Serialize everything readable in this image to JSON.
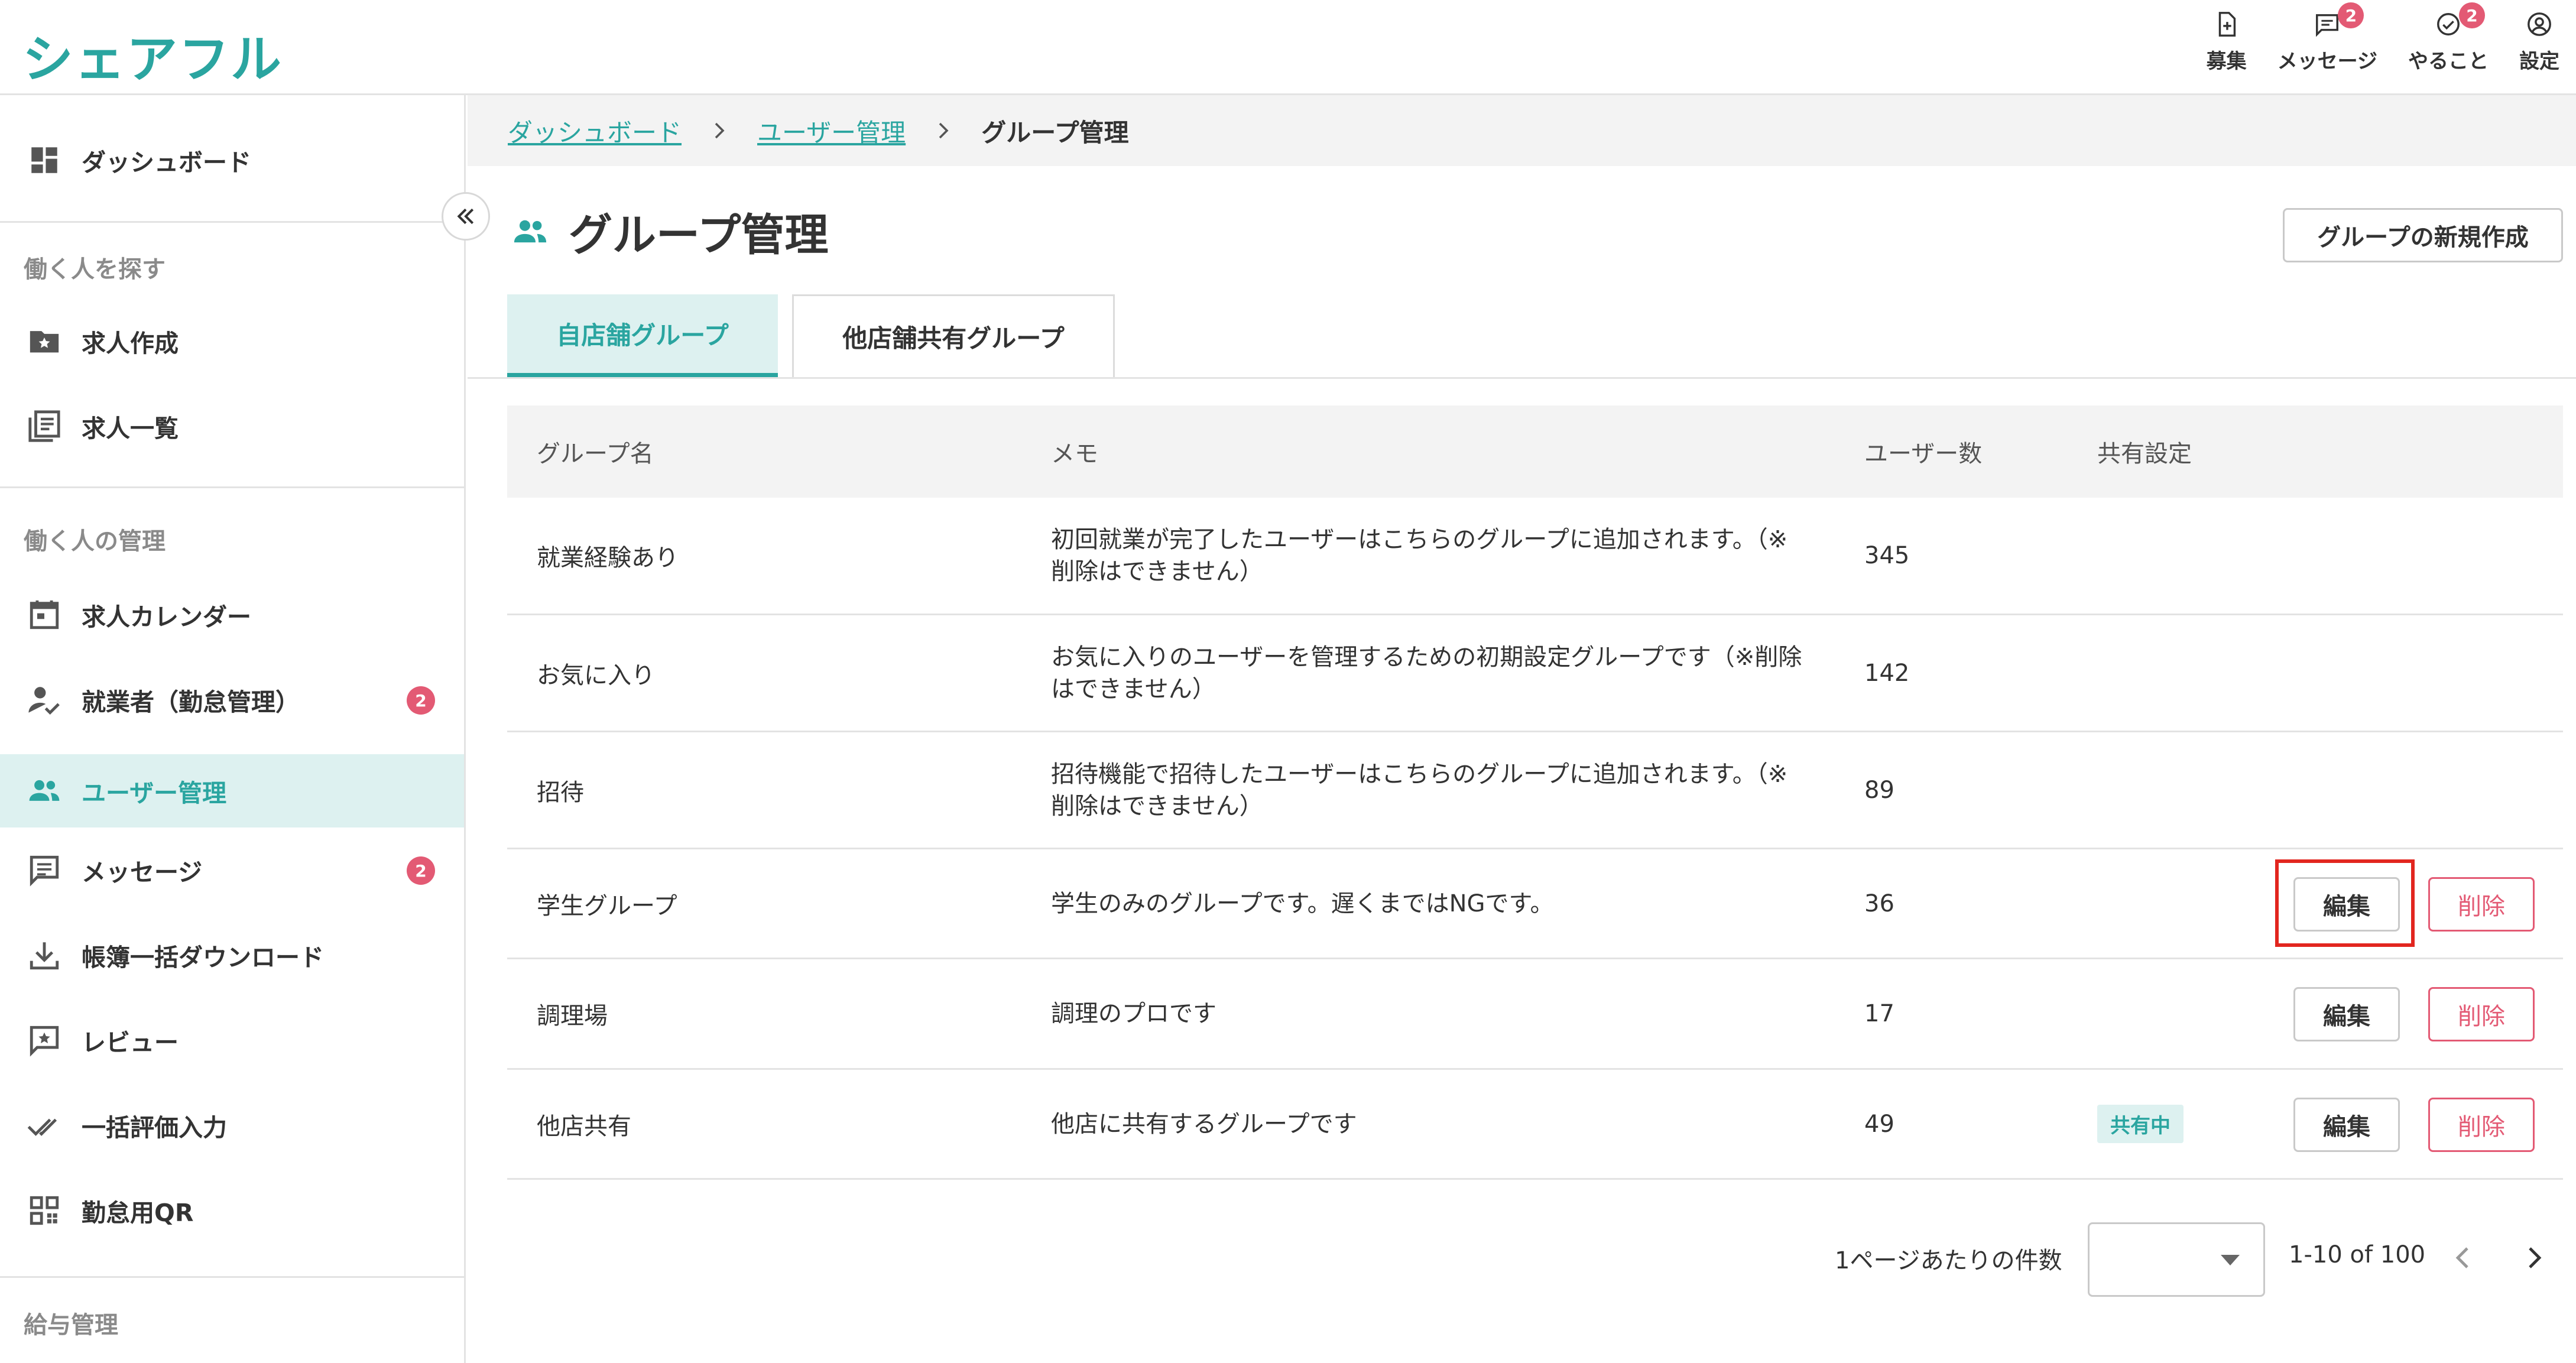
{
  "app": {
    "logo": "シェアフル"
  },
  "header": {
    "items": [
      {
        "label": "募集",
        "icon": "add-document-icon",
        "badge": ""
      },
      {
        "label": "メッセージ",
        "icon": "message-icon",
        "badge": "2"
      },
      {
        "label": "やること",
        "icon": "check-circle-icon",
        "badge": "2"
      },
      {
        "label": "設定",
        "icon": "account-circle-icon",
        "badge": ""
      }
    ]
  },
  "sidebar": {
    "dashboard": "ダッシュボード",
    "section_find": "働く人を探す",
    "job_create": "求人作成",
    "job_list": "求人一覧",
    "section_manage": "働く人の管理",
    "job_calendar": "求人カレンダー",
    "workers": "就業者（勤怠管理）",
    "workers_badge": "2",
    "user_management": "ユーザー管理",
    "messages": "メッセージ",
    "messages_badge": "2",
    "ledger_download": "帳簿一括ダウンロード",
    "review": "レビュー",
    "bulk_rating": "一括評価入力",
    "attendance_qr": "勤怠用QR",
    "section_payroll": "給与管理"
  },
  "breadcrumb": {
    "items": [
      "ダッシュボード",
      "ユーザー管理"
    ],
    "current": "グループ管理"
  },
  "page": {
    "title": "グループ管理",
    "new_group_button": "グループの新規作成",
    "tabs": [
      "自店舗グループ",
      "他店舗共有グループ"
    ],
    "active_tab": 0
  },
  "table": {
    "columns": [
      "グループ名",
      "メモ",
      "ユーザー数",
      "共有設定"
    ],
    "edit_label": "編集",
    "delete_label": "削除",
    "rows": [
      {
        "name": "就業経験あり",
        "memo": "初回就業が完了したユーザーはこちらのグループに追加されます。（※削除はできません）",
        "count": "345",
        "share": ""
      },
      {
        "name": "お気に入り",
        "memo": "お気に入りのユーザーを管理するための初期設定グループです（※削除はできません）",
        "count": "142",
        "share": ""
      },
      {
        "name": "招待",
        "memo": "招待機能で招待したユーザーはこちらのグループに追加されます。（※削除はできません）",
        "count": "89",
        "share": ""
      },
      {
        "name": "学生グループ",
        "memo": "学生のみのグループです。遅くまではNGです。",
        "count": "36",
        "share": ""
      },
      {
        "name": "調理場",
        "memo": "調理のプロです",
        "count": "17",
        "share": ""
      },
      {
        "name": "他店共有",
        "memo": "他店に共有するグループです",
        "count": "49",
        "share": "共有中"
      }
    ]
  },
  "pagination": {
    "per_page_label": "1ページあたりの件数",
    "per_page_value": "",
    "range": "1-10 of 100"
  },
  "colors": {
    "accent": "#2aa5a0",
    "danger": "#e35a74",
    "highlight": "#e2261f"
  }
}
